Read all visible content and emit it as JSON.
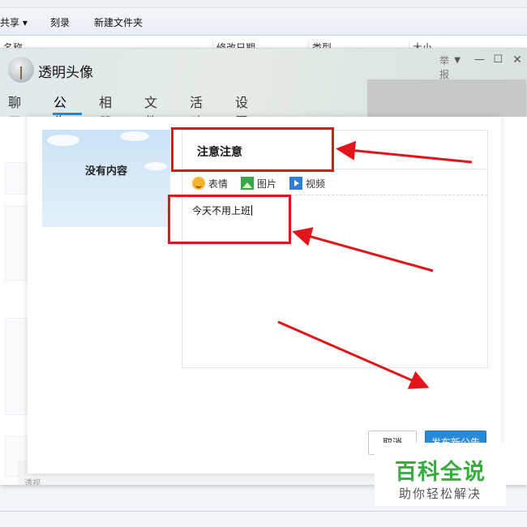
{
  "explorer": {
    "toolbar": [
      "共享 ▾",
      "刻录",
      "新建文件夹"
    ],
    "columns": [
      "名称",
      "修改日期",
      "类型",
      "大小"
    ]
  },
  "group_window": {
    "title": "透明头像",
    "report_label": "举报",
    "tabs": [
      "聊天",
      "公告",
      "相册",
      "文件",
      "活动",
      "设置"
    ],
    "active_tab": "公告",
    "bottom_ghost_text": "透视"
  },
  "announcement": {
    "preview_text": "没有内容",
    "title_value": "注意注意",
    "toolbar": [
      {
        "label": "表情",
        "icon": "emoji-icon"
      },
      {
        "label": "图片",
        "icon": "picture-icon"
      },
      {
        "label": "视频",
        "icon": "video-icon"
      }
    ],
    "body_value": "今天不用上班",
    "cancel_label": "取消",
    "publish_label": "发布新公告"
  },
  "watermark": {
    "title": "百科全说",
    "subtitle": "助你轻松解决"
  },
  "colors": {
    "accent_blue": "#2b8ad8",
    "annotation_red": "#e2151b",
    "watermark_green": "#3aab3f"
  }
}
